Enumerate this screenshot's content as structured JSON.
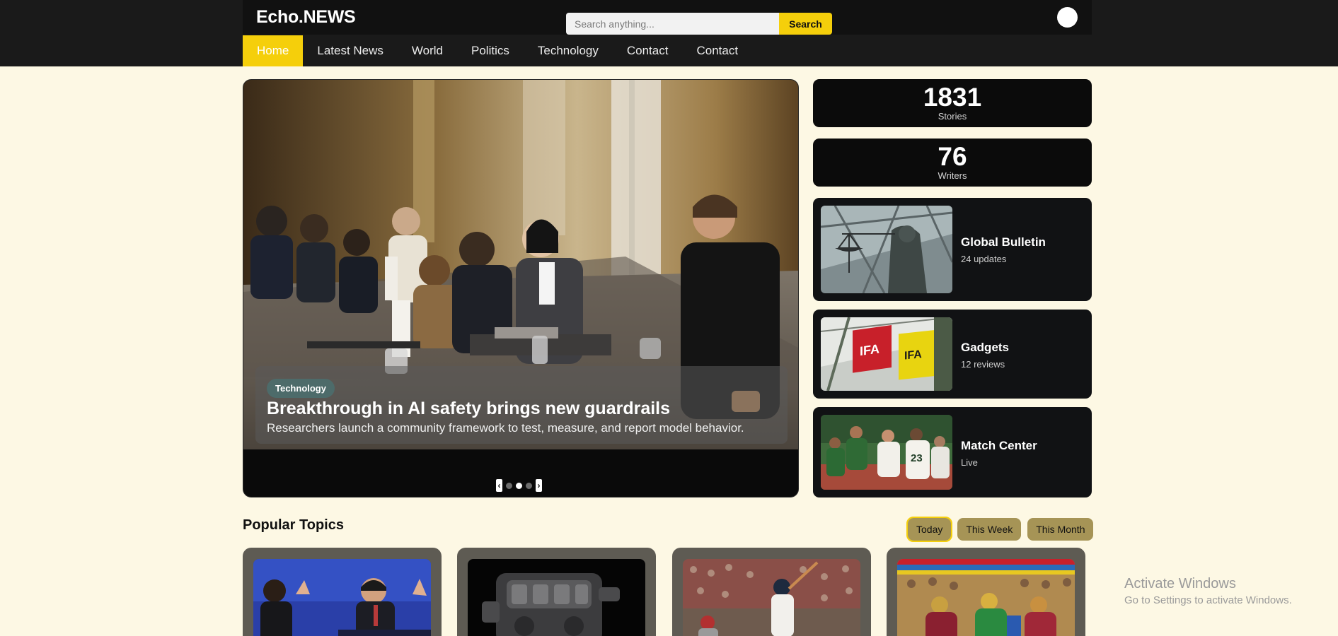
{
  "header": {
    "brand": "Echo.NEWS",
    "search": {
      "placeholder": "Search anything...",
      "value": "",
      "button_label": "Search"
    },
    "accent_color": "#f5cf0b",
    "avatar_icon": "user-avatar-circle"
  },
  "nav": {
    "items": [
      {
        "label": "Home",
        "active": true
      },
      {
        "label": "Latest News"
      },
      {
        "label": "World"
      },
      {
        "label": "Politics"
      },
      {
        "label": "Technology"
      },
      {
        "label": "Contact"
      },
      {
        "label": "Contact"
      }
    ]
  },
  "hero": {
    "tag": "Technology",
    "title": "Breakthrough in AI safety brings new guardrails",
    "subtitle": "Researchers launch a community framework to test, measure, and report model behavior.",
    "slider": {
      "prev_icon": "chevron-left-icon",
      "next_icon": "chevron-right-icon",
      "slide_count": 3,
      "active_slide": 2
    }
  },
  "stats": [
    {
      "value": "1831",
      "label": "Stories"
    },
    {
      "value": "76",
      "label": "Writers"
    }
  ],
  "features": [
    {
      "title": "Global Bulletin",
      "meta": "24 updates"
    },
    {
      "title": "Gadgets",
      "meta": "12 reviews"
    },
    {
      "title": "Match Center",
      "meta": "Live"
    }
  ],
  "popular": {
    "title": "Popular Topics",
    "filters": [
      {
        "label": "Today",
        "active": true
      },
      {
        "label": "This Week"
      },
      {
        "label": "This Month"
      }
    ]
  },
  "watermark": {
    "title": "Activate Windows",
    "subtitle": "Go to Settings to activate Windows."
  }
}
